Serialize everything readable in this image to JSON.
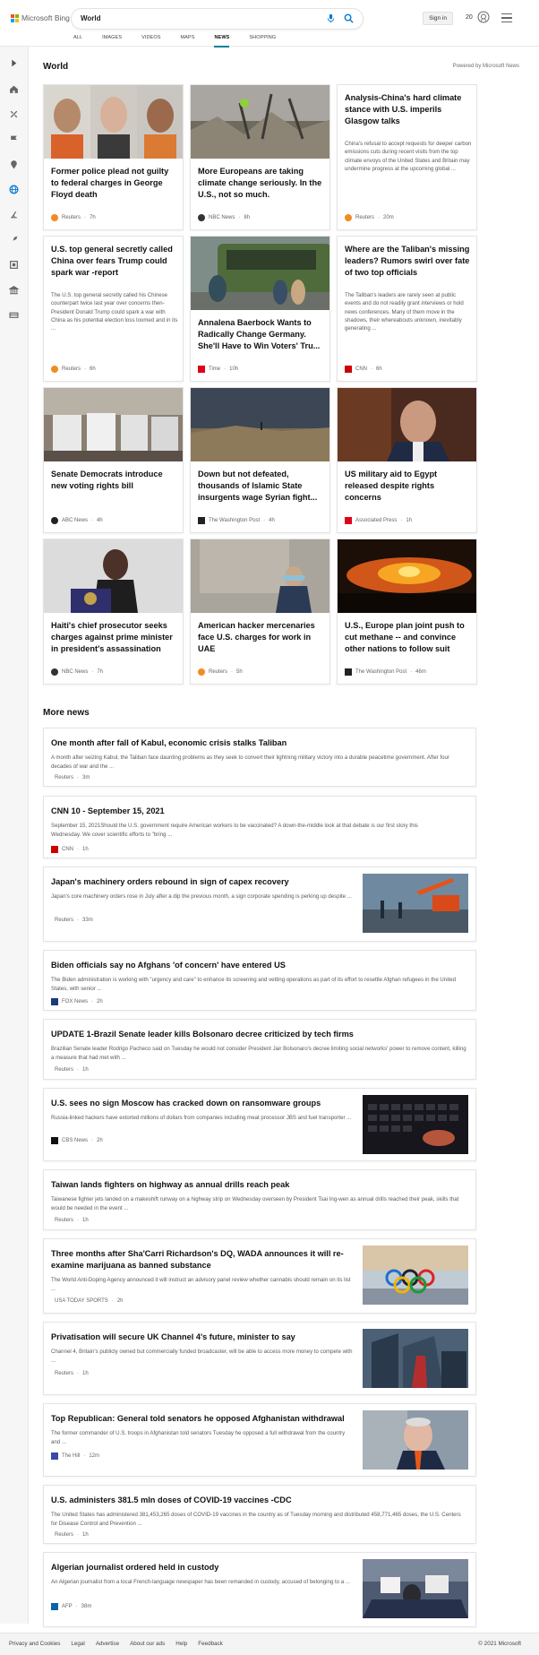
{
  "header": {
    "brand": "Microsoft Bing",
    "query": "World",
    "signin": "Sign in",
    "points": "20"
  },
  "tabs": [
    "ALL",
    "IMAGES",
    "VIDEOS",
    "MAPS",
    "NEWS",
    "SHOPPING"
  ],
  "active_tab": "NEWS",
  "world": {
    "title": "World",
    "powered": "Powered by Microsoft News",
    "cards": [
      {
        "title": "Former police plead not guilty to federal charges in George Floyd death",
        "snippet": "",
        "source": "Reuters",
        "time": "7h",
        "icon": "reuters-icon"
      },
      {
        "title": "More Europeans are taking climate change seriously. In the U.S., not so much.",
        "snippet": "",
        "source": "NBC News",
        "time": "8h",
        "icon": "nbc-icon"
      },
      {
        "title": "Analysis-China's hard climate stance with U.S. imperils Glasgow talks",
        "snippet": "China's refusal to accept requests for deeper carbon emissions cuts during recent visits from the top climate envoys of the United States and Britain may undermine progress at the upcoming global ...",
        "source": "Reuters",
        "time": "20m",
        "icon": "reuters-icon"
      },
      {
        "title": "U.S. top general secretly called China over fears Trump could spark war -report",
        "snippet": "The U.S. top general secretly called his Chinese counterpart twice last year over concerns then-President Donald Trump could spark a war with China as his potential election loss loomed and in its ...",
        "source": "Reuters",
        "time": "6h",
        "icon": "reuters-icon"
      },
      {
        "title": "Annalena Baerbock Wants to Radically Change Germany. She'll Have to Win Voters' Tru...",
        "snippet": "",
        "source": "Time",
        "time": "10h",
        "icon": "time-icon"
      },
      {
        "title": "Where are the Taliban's missing leaders? Rumors swirl over fate of two top officials",
        "snippet": "The Taliban's leaders are rarely seen at public events and do not readily grant interviews or hold news conferences. Many of them move in the shadows, their whereabouts unknown, inevitably generating ...",
        "source": "CNN",
        "time": "6h",
        "icon": "cnn-icon"
      },
      {
        "title": "Senate Democrats introduce new voting rights bill",
        "snippet": "",
        "source": "ABC News",
        "time": "4h",
        "icon": "abc-icon"
      },
      {
        "title": "Down but not defeated, thousands of Islamic State insurgents wage Syrian fight...",
        "snippet": "",
        "source": "The Washington Post",
        "time": "4h",
        "icon": "wapo-icon"
      },
      {
        "title": "US military aid to Egypt released despite rights concerns",
        "snippet": "",
        "source": "Associated Press",
        "time": "1h",
        "icon": "ap-icon"
      },
      {
        "title": "Haiti's chief prosecutor seeks charges against prime minister in president's assassination",
        "snippet": "",
        "source": "NBC News",
        "time": "7h",
        "icon": "nbc-icon"
      },
      {
        "title": "American hacker mercenaries face U.S. charges for work in UAE",
        "snippet": "",
        "source": "Reuters",
        "time": "5h",
        "icon": "reuters-icon"
      },
      {
        "title": "U.S., Europe plan joint push to cut methane -- and convince other nations to follow suit",
        "snippet": "",
        "source": "The Washington Post",
        "time": "46m",
        "icon": "wapo-icon"
      }
    ]
  },
  "more_news": {
    "title": "More news",
    "items": [
      {
        "title": "One month after fall of Kabul, economic crisis stalks Taliban",
        "snippet": "A month after seizing Kabul, the Taliban face daunting problems as they seek to convert their lightning military victory into a durable peacetime government. After four decades of war and the ...",
        "source": "Reuters",
        "time": "3m",
        "icon": "reuters-icon"
      },
      {
        "title": "CNN 10 - September 15, 2021",
        "snippet": "September 15, 2021Should the U.S. government require American workers to be vaccinated? A down-the-middle look at that debate is our first story this Wednesday. We cover scientific efforts to \"bring ...",
        "source": "CNN",
        "time": "1h",
        "icon": "cnn-icon"
      },
      {
        "title": "Japan's machinery orders rebound in sign of capex recovery",
        "snippet": "Japan's core machinery orders rose in July after a dip the previous month, a sign corporate spending is perking up despite ...",
        "source": "Reuters",
        "time": "33m",
        "icon": "reuters-icon"
      },
      {
        "title": "Biden officials say no Afghans 'of concern' have entered US",
        "snippet": "The Biden administration is working with \"urgency and care\" to enhance its screening and vetting operations as part of its effort to resettle Afghan refugees in the United States, with senior ...",
        "source": "FOX News",
        "time": "2h",
        "icon": "fox-icon"
      },
      {
        "title": "UPDATE 1-Brazil Senate leader kills Bolsonaro decree criticized by tech firms",
        "snippet": "Brazilian Senate leader Rodrigo Pacheco said on Tuesday he would not consider President Jair Bolsonaro's decree limiting social networks' power to remove content, killing a measure that had met with ...",
        "source": "Reuters",
        "time": "1h",
        "icon": "reuters-icon"
      },
      {
        "title": "U.S. sees no sign Moscow has cracked down on ransomware groups",
        "snippet": "Russia-linked hackers have extorted millions of dollars from companies including meat processor JBS and fuel transporter ...",
        "source": "CBS News",
        "time": "2h",
        "icon": "cbs-icon"
      },
      {
        "title": "Taiwan lands fighters on highway as annual drills reach peak",
        "snippet": "Taiwanese fighter jets landed on a makeshift runway on a highway strip on Wednesday overseen by President Tsai Ing-wen as annual drills reached their peak, skills that would be needed in the event ...",
        "source": "Reuters",
        "time": "1h",
        "icon": "reuters-icon"
      },
      {
        "title": "Three months after Sha'Carri Richardson's DQ, WADA announces it will re-examine marijuana as banned substance",
        "snippet": "The World Anti-Doping Agency announced it will instruct an advisory panel review whether cannabis should remain on its list ...",
        "source": "USA TODAY SPORTS",
        "time": "2h",
        "icon": "usatoday-icon"
      },
      {
        "title": "Privatisation will secure UK Channel 4's future, minister to say",
        "snippet": "Channel 4, Britain's publicly owned but commercially funded broadcaster, will be able to access more money to compete with ...",
        "source": "Reuters",
        "time": "1h",
        "icon": "reuters-icon"
      },
      {
        "title": "Top Republican: General told senators he opposed Afghanistan withdrawal",
        "snippet": "The former commander of U.S. troops in Afghanistan told senators Tuesday he opposed a full withdrawal from the country and ...",
        "source": "The Hill",
        "time": "12m",
        "icon": "thehill-icon"
      },
      {
        "title": "U.S. administers 381.5 mln doses of COVID-19 vaccines -CDC",
        "snippet": "The United States has administered 381,453,265 doses of COVID-19 vaccines in the country as of Tuesday morning and distributed 458,771,465 doses, the U.S. Centers for Disease Control and Prevention ...",
        "source": "Reuters",
        "time": "1h",
        "icon": "reuters-icon"
      },
      {
        "title": "Algerian journalist ordered held in custody",
        "snippet": "An Algerian journalist from a local French-language newspaper has been remanded in custody, accused of belonging to a ...",
        "source": "AFP",
        "time": "38m",
        "icon": "afp-icon"
      }
    ]
  },
  "footer": {
    "links": [
      "Privacy and Cookies",
      "Legal",
      "Advertise",
      "About our ads",
      "Help",
      "Feedback"
    ],
    "copyright": "© 2021 Microsoft"
  },
  "colors": {
    "accent": "#00809d",
    "bing_blue": "#0078d4"
  }
}
